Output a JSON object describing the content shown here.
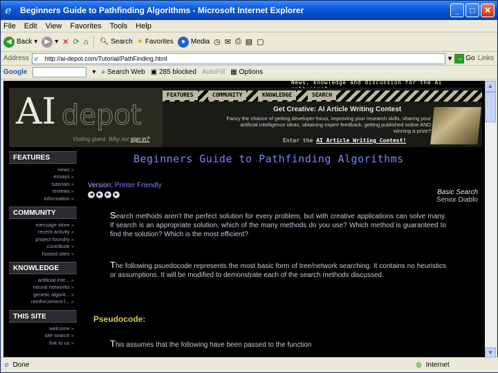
{
  "window": {
    "title": "Beginners Guide to Pathfinding Algorithms - Microsoft Internet Explorer"
  },
  "menu": [
    "File",
    "Edit",
    "View",
    "Favorites",
    "Tools",
    "Help"
  ],
  "toolbar": {
    "back": "Back",
    "search": "Search",
    "favorites": "Favorites",
    "media": "Media"
  },
  "address": {
    "label": "Address",
    "url": "http://ai-depot.com/Tutorial/PathFinding.html",
    "go": "Go",
    "links": "Links"
  },
  "googlebar": {
    "label": "Google",
    "search_web": "Search Web",
    "blocked": "285 blocked",
    "autofill": "AutoFill",
    "options": "Options"
  },
  "site": {
    "tagline": "News, knowledge and discussion for the AI enthusiast.",
    "logo_ai": "AI",
    "logo_depot": "depot",
    "visiting": "Visiting guest. Why not",
    "sign_in": "sign in?",
    "nav": [
      "FEATURES",
      "COMMUNITY",
      "KNOWLEDGE",
      "SEARCH"
    ],
    "contest_title": "Get Creative: AI Article Writing Contest",
    "contest_text": "Fancy the chance of getting developer focus, improving your research skills, sharing your artificial intelligence ideas, obtaining expert feedback, getting published online AND winning a prize?",
    "enter": "Enter the",
    "enter_link": "AI Article Writing Contest!"
  },
  "sidebar": [
    {
      "title": "FEATURES",
      "items": [
        "news",
        "essays",
        "tutorials",
        "reviews",
        "information"
      ]
    },
    {
      "title": "COMMUNITY",
      "items": [
        "message store",
        "recent activity",
        "project foundry",
        "contribute",
        "hosted sites"
      ]
    },
    {
      "title": "KNOWLEDGE",
      "items": [
        "artificial inte...",
        "neural networks",
        "genetic algorit...",
        "reinforcement l..."
      ]
    },
    {
      "title": "THIS SITE",
      "items": [
        "welcome",
        "site search",
        "link to us"
      ]
    }
  ],
  "article": {
    "title": "Beginners Guide to Pathfinding Algorithms",
    "version_label": "Version:",
    "version_value": "Printer Friendly",
    "section": "Basic Search",
    "author": "Senior Diablo",
    "para1": "Search methods aren't the perfect solution for every problem, but with creative applications can solve many. If search is an appropriate solution, which of the many methods do you use? Which method is guaranteed to find the solution? Which is the most efficient?",
    "para2": "The following psuedocode represents the most basic form of tree/network searching. It contains no heuristics or assumptions. It will be modified to demonstrate each of the search methods discussed.",
    "pseudo_heading": "Pseudocode:",
    "para3": "This assumes that the following have been passed to the function"
  },
  "status": {
    "text": "Done",
    "zone": "Internet"
  }
}
